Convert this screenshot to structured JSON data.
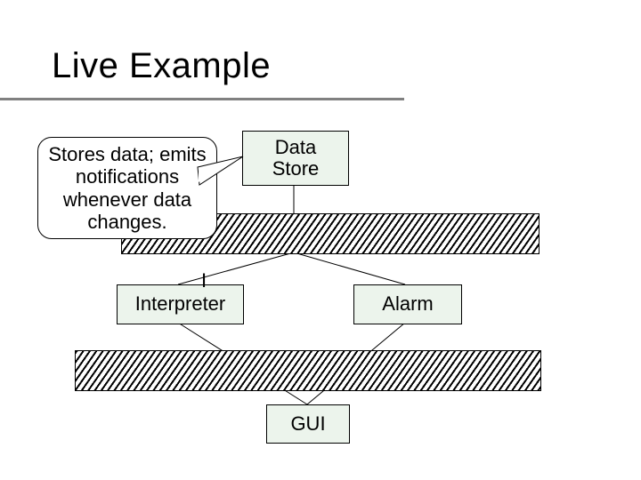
{
  "title": "Live Example",
  "nodes": {
    "data_store": "Data\nStore",
    "interpreter": "Interpreter",
    "alarm": "Alarm",
    "gui": "GUI",
    "partial_i": "I"
  },
  "callout": {
    "text": "Stores data; emits notifications whenever data changes."
  }
}
